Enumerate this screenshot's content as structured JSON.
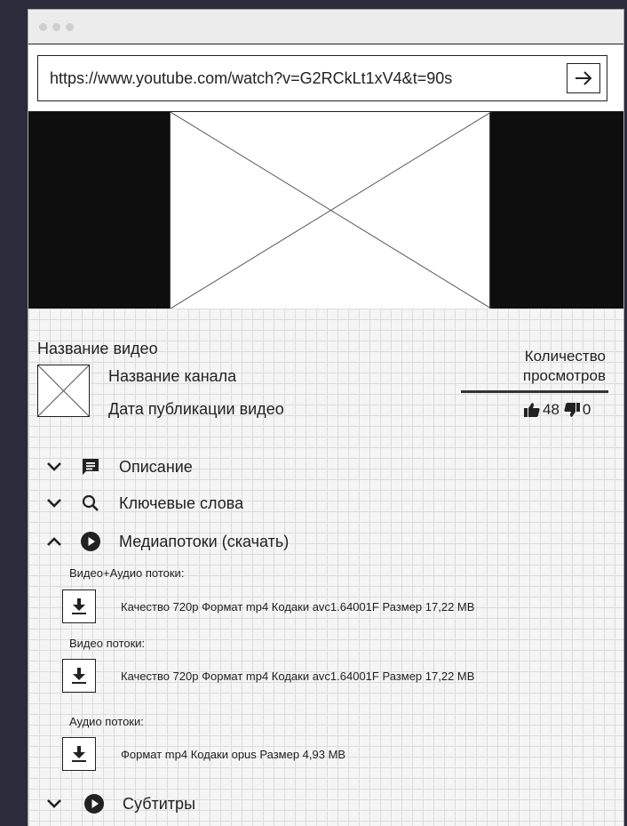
{
  "browser": {
    "url": "https://www.youtube.com/watch?v=G2RCkLt1xV4&t=90s",
    "go_icon": "arrow-right-icon"
  },
  "video": {
    "title": "Название видео",
    "channel": "Название канала",
    "published": "Дата публикации видео",
    "views_label": "Количество просмотров",
    "likes": "48",
    "dislikes": "0"
  },
  "sections": [
    {
      "label": "Описание",
      "icon": "comment-icon",
      "expanded": false
    },
    {
      "label": "Ключевые слова",
      "icon": "search-icon",
      "expanded": false
    },
    {
      "label": "Медиапотоки (скачать)",
      "icon": "play-circle-icon",
      "expanded": true
    },
    {
      "label": "Субтитры",
      "icon": "play-circle-icon",
      "expanded": false
    }
  ],
  "streams": {
    "video_audio_label": "Видео+Аудио потоки:",
    "video_audio_item": "Качество 720p Формат mp4 Кодаки avc1.64001F Размер 17,22 MB",
    "video_label": "Видео потоки:",
    "video_item": "Качество 720p Формат mp4 Кодаки avc1.64001F Размер 17,22 MB",
    "audio_label": "Аудио потоки:",
    "audio_item": "Формат mp4 Кодаки opus Размер 4,93 MB"
  }
}
